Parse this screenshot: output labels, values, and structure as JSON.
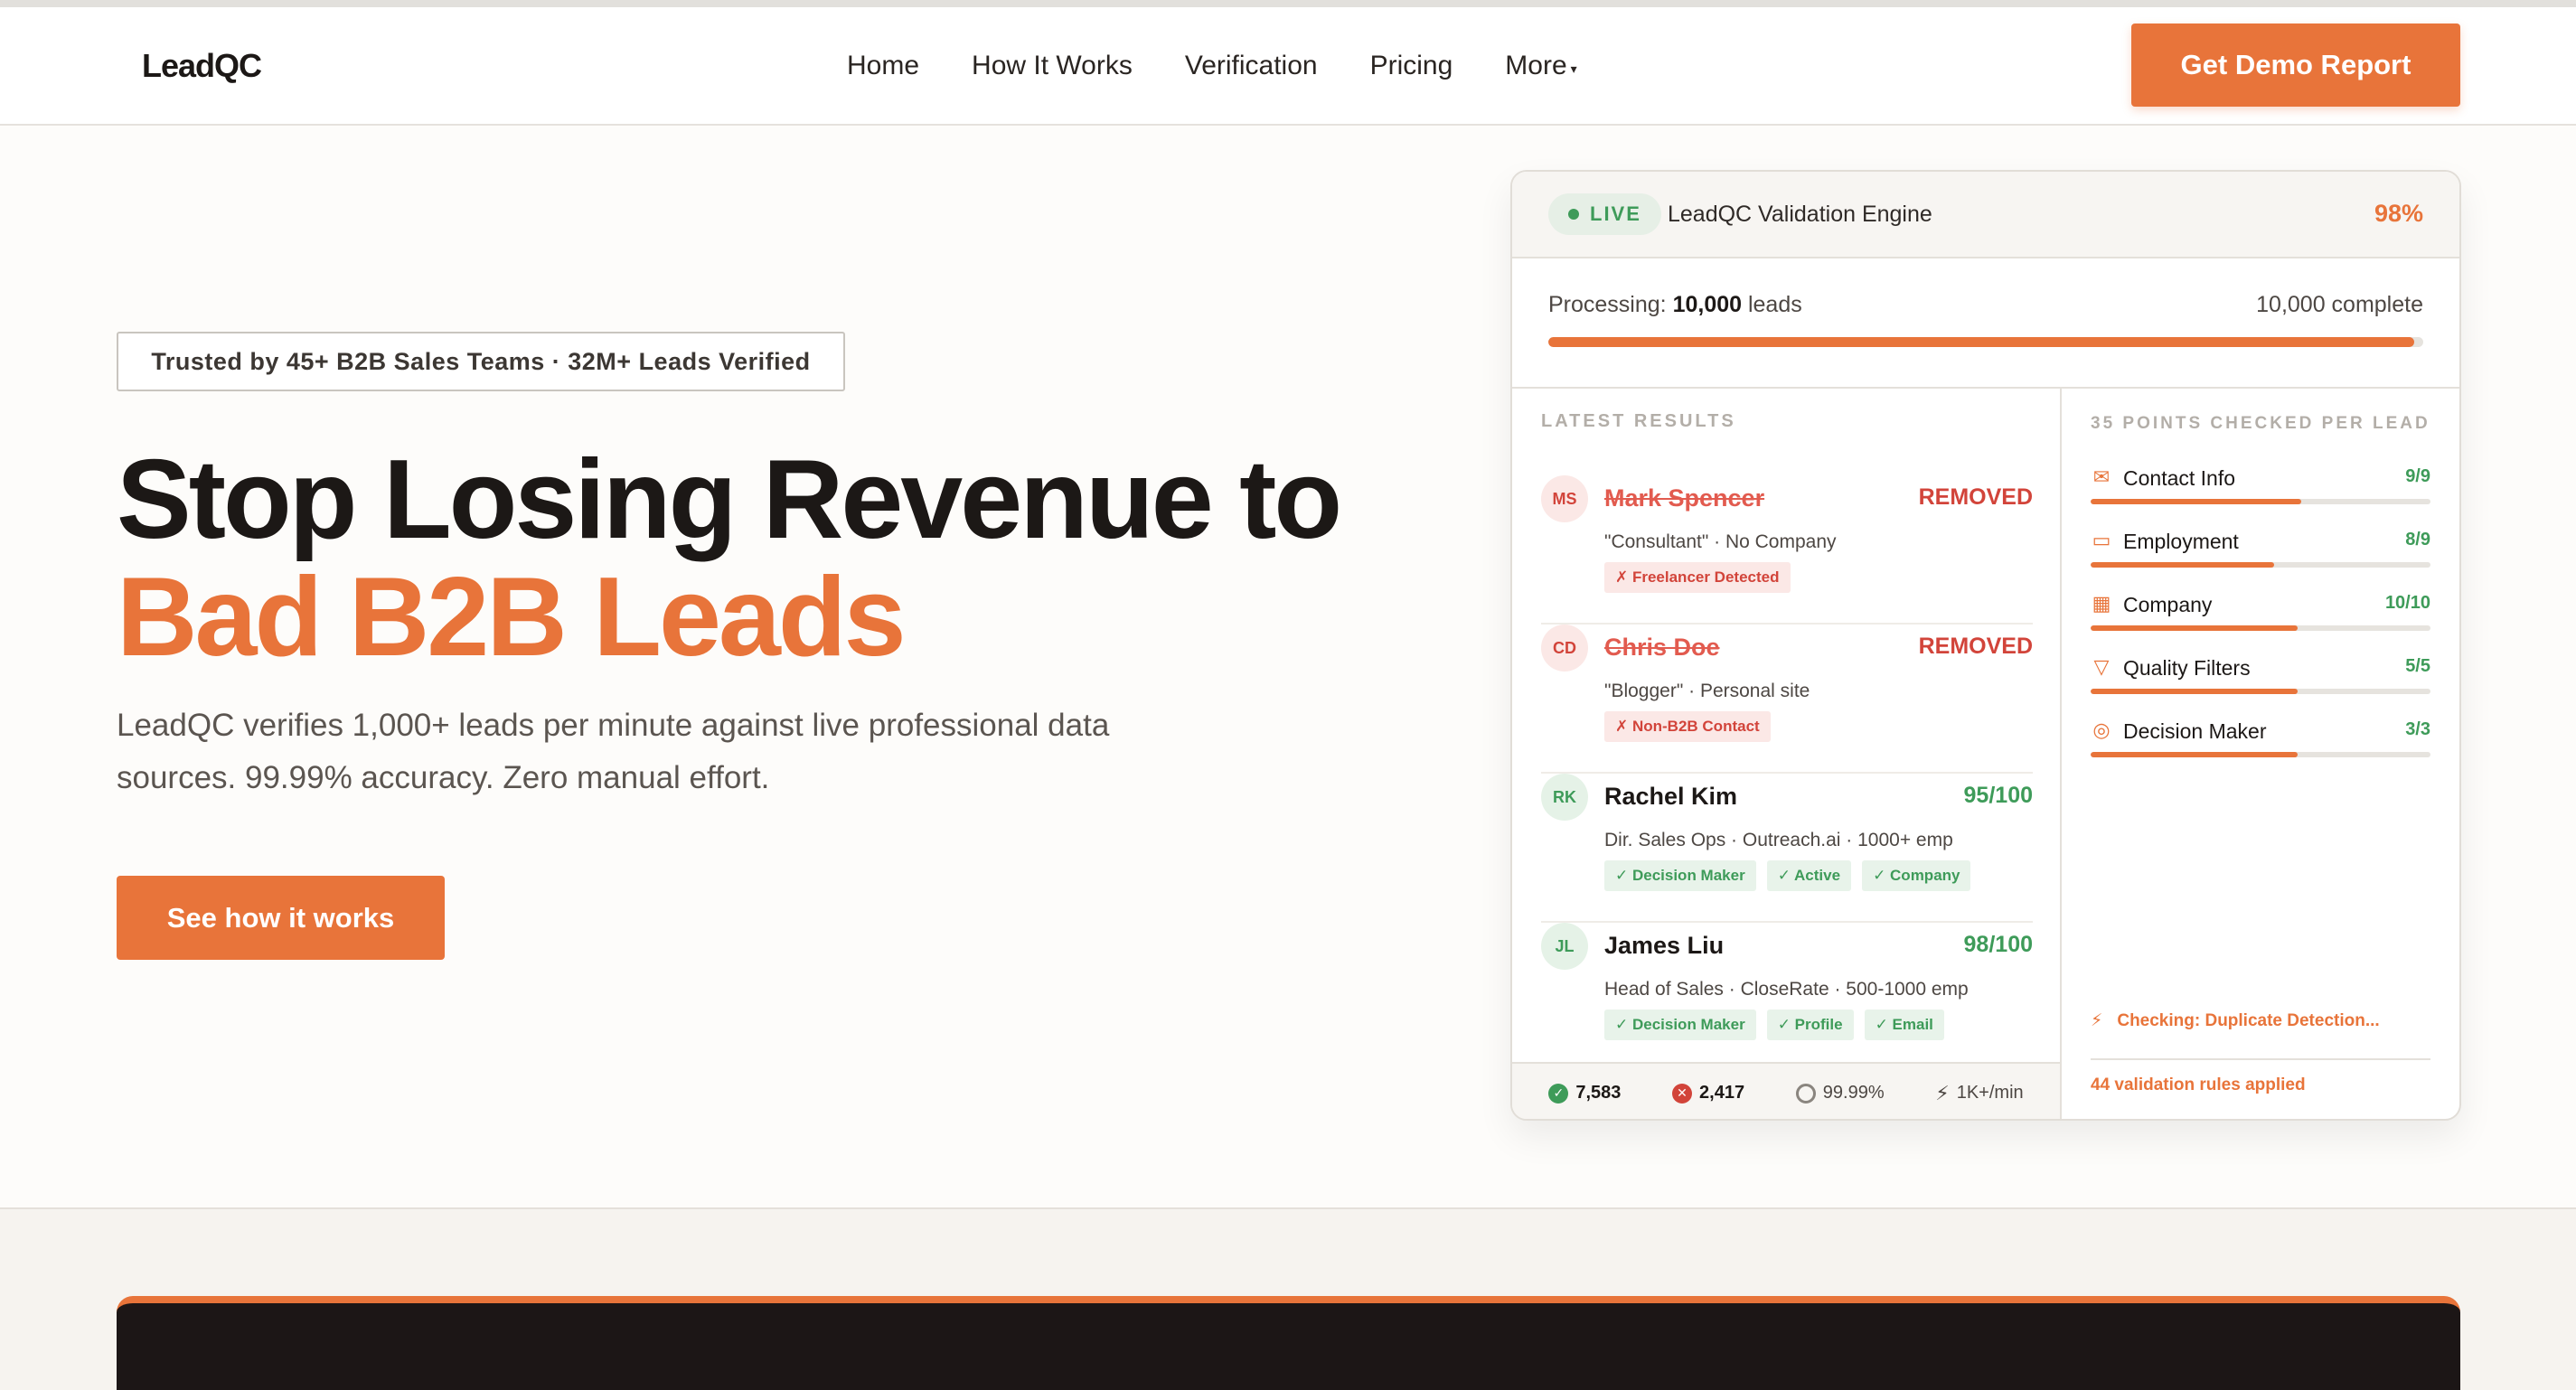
{
  "header": {
    "logo": "LeadQC",
    "nav": [
      {
        "label": "Home"
      },
      {
        "label": "How It Works"
      },
      {
        "label": "Verification"
      },
      {
        "label": "Pricing"
      },
      {
        "label": "More"
      }
    ],
    "cta_label": "Get Demo Report"
  },
  "hero": {
    "trusted": "Trusted by 45+ B2B Sales Teams · 32M+ Leads Verified",
    "title_line1": "Stop Losing Revenue to",
    "title_line2": "Bad B2B Leads",
    "subtitle": "LeadQC verifies 1,000+ leads per minute against live professional data sources. 99.99% accuracy. Zero manual effort.",
    "cta_label": "See how it works"
  },
  "card": {
    "live_label": "LIVE",
    "engine": "LeadQC Validation Engine",
    "percent": "98%",
    "processing_prefix": "Processing: ",
    "processing_count": "10,000",
    "processing_suffix": " leads",
    "complete": "10,000 complete",
    "progress": 0.99,
    "results_label": "LATEST RESULTS",
    "results": [
      {
        "initials": "MS",
        "name": "Mark Spencer",
        "status": "REMOVED",
        "desc": "\"Consultant\" · No Company",
        "tags": [
          "✗ Freelancer Detected"
        ]
      },
      {
        "initials": "CD",
        "name": "Chris Doe",
        "status": "REMOVED",
        "desc": "\"Blogger\" · Personal site",
        "tags": [
          "✗ Non-B2B Contact"
        ]
      },
      {
        "initials": "RK",
        "name": "Rachel Kim",
        "status": "95/100",
        "desc": "Dir. Sales Ops · Outreach.ai · 1000+ emp",
        "tags": [
          "✓ Decision Maker",
          "✓ Active",
          "✓ Company"
        ]
      },
      {
        "initials": "JL",
        "name": "James Liu",
        "status": "98/100",
        "desc": "Head of Sales · CloseRate · 500-1000 emp",
        "tags": [
          "✓ Decision Maker",
          "✓ Profile",
          "✓ Email"
        ]
      }
    ],
    "stats": {
      "valid": "7,583",
      "removed": "2,417",
      "accuracy": "99.99%",
      "speed": "1K+/min"
    },
    "checks_label": "35 POINTS CHECKED PER LEAD",
    "checks": [
      {
        "icon": "envelope-icon",
        "label": "Contact Info",
        "value": "9/9",
        "fill": 0.62
      },
      {
        "icon": "briefcase-icon",
        "label": "Employment",
        "value": "8/9",
        "fill": 0.54
      },
      {
        "icon": "building-icon",
        "label": "Company",
        "value": "10/10",
        "fill": 0.61
      },
      {
        "icon": "filter-icon",
        "label": "Quality Filters",
        "value": "5/5",
        "fill": 0.61
      },
      {
        "icon": "target-icon",
        "label": "Decision Maker",
        "value": "3/3",
        "fill": 0.61
      }
    ],
    "checking": "Checking: Duplicate Detection...",
    "rules": "44 validation rules applied"
  },
  "colors": {
    "accent": "#e8743a",
    "success": "#3e9b59",
    "danger": "#d2443a",
    "dark": "#1c1616"
  }
}
